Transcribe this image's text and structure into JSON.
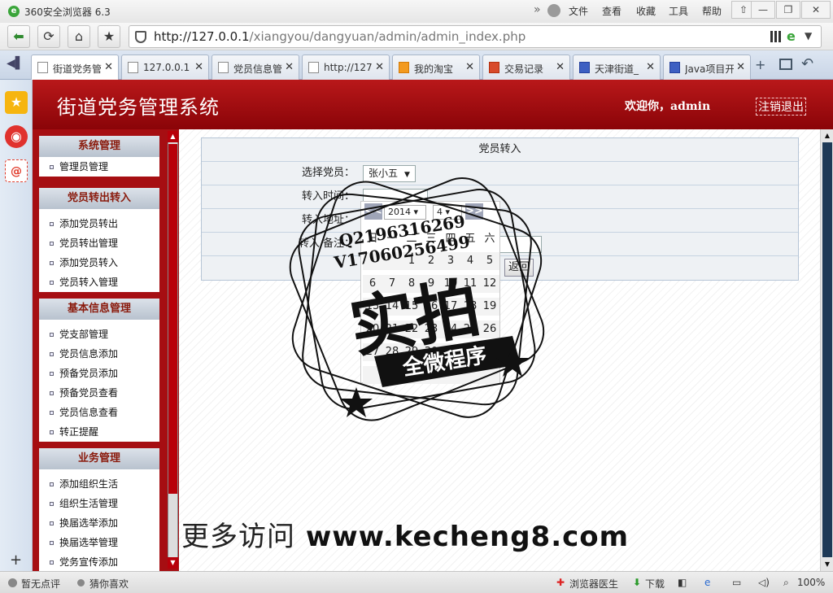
{
  "window": {
    "title": "360安全浏览器 6.3",
    "menus": [
      "文件",
      "查看",
      "收藏",
      "工具",
      "帮助"
    ]
  },
  "address_bar": {
    "url_host": "http://127.0.0.1",
    "url_path": "/xiangyou/dangyuan/admin/admin_index.php"
  },
  "tabs": [
    {
      "label": "街道党务管",
      "icon": "page-icon",
      "active": true
    },
    {
      "label": "127.0.0.1",
      "icon": "page-icon"
    },
    {
      "label": "党员信息管",
      "icon": "page-icon"
    },
    {
      "label": "http://127",
      "icon": "page-icon"
    },
    {
      "label": "我的淘宝",
      "icon": "taobao-icon"
    },
    {
      "label": "交易记录",
      "icon": "alipay-icon"
    },
    {
      "label": "天津街道_",
      "icon": "baidu-icon"
    },
    {
      "label": "Java项目开",
      "icon": "baidu-icon"
    }
  ],
  "header": {
    "title": "街道党务管理系统",
    "welcome": "欢迎你，admin",
    "logout": "注销退出",
    "bg_color": "#a60e12"
  },
  "sidebar": {
    "groups": [
      {
        "title": "系统管理",
        "items": [
          "管理员管理"
        ]
      },
      {
        "title": "党员转出转入",
        "items": [
          "添加党员转出",
          "党员转出管理",
          "添加党员转入",
          "党员转入管理"
        ]
      },
      {
        "title": "基本信息管理",
        "items": [
          "党支部管理",
          "党员信息添加",
          "预备党员添加",
          "预备党员查看",
          "党员信息查看",
          "转正提醒"
        ]
      },
      {
        "title": "业务管理",
        "items": [
          "添加组织生活",
          "组织生活管理",
          "换届选举添加",
          "换届选举管理",
          "党务宣传添加"
        ]
      }
    ]
  },
  "form": {
    "title": "党员转入",
    "member_label": "选择党员：",
    "member_value": "张小五",
    "time_label": "转入时间：",
    "address_label": "转入地址：",
    "remark_label": "转入 备注：",
    "back_button": "返回"
  },
  "calendar": {
    "prev": "<<",
    "next": ">>",
    "year": "2014",
    "month": "4",
    "weekdays": [
      "日",
      "一",
      "二",
      "三",
      "四",
      "五",
      "六"
    ],
    "days": [
      "",
      "",
      "1",
      "2",
      "3",
      "4",
      "5",
      "6",
      "7",
      "8",
      "9",
      "10",
      "11",
      "12",
      "13",
      "14",
      "15",
      "16",
      "17",
      "18",
      "19",
      "20",
      "21",
      "22",
      "23",
      "24",
      "25",
      "26",
      "27",
      "28",
      "29",
      "30",
      "",
      "",
      "",
      "",
      "",
      "",
      "",
      "",
      "",
      ""
    ]
  },
  "watermark": {
    "line1": "Q2196316269",
    "line2": "V17060256499",
    "big": "实拍",
    "ribbon": "全微程序",
    "footer_cn": "更多访问",
    "footer_url": "www.kecheng8.com"
  },
  "statusbar": {
    "left1": "暂无点评",
    "left2": "猜你喜欢",
    "doctor": "浏览器医生",
    "download": "下载",
    "zoom": "100%"
  }
}
